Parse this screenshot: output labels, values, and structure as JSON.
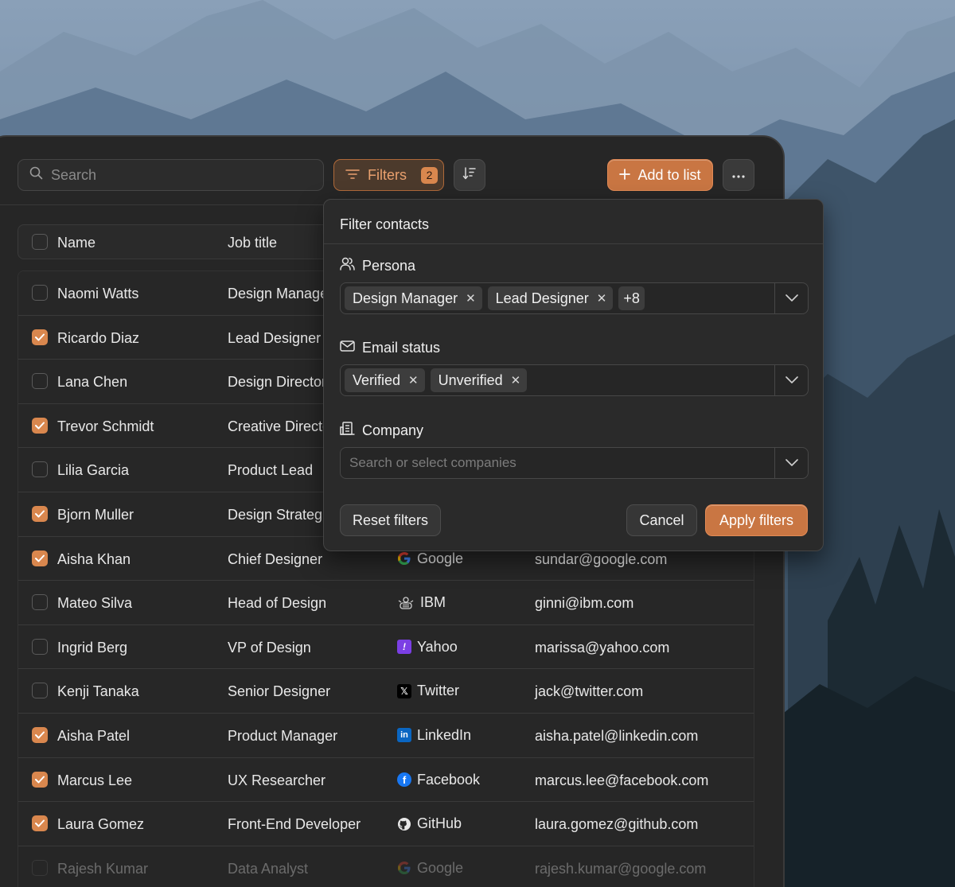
{
  "toolbar": {
    "search_placeholder": "Search",
    "filters_label": "Filters",
    "filters_count": "2",
    "add_label": "Add to list"
  },
  "table": {
    "headers": {
      "name": "Name",
      "job_title": "Job title"
    },
    "rows": [
      {
        "checked": false,
        "name": "Naomi Watts",
        "job": "Design Manager",
        "company": "",
        "company_icon": "",
        "email": ""
      },
      {
        "checked": true,
        "name": "Ricardo Diaz",
        "job": "Lead Designer",
        "company": "",
        "company_icon": "",
        "email": ""
      },
      {
        "checked": false,
        "name": "Lana Chen",
        "job": "Design Director",
        "company": "",
        "company_icon": "",
        "email": ""
      },
      {
        "checked": true,
        "name": "Trevor Schmidt",
        "job": "Creative Director",
        "company": "",
        "company_icon": "",
        "email": ""
      },
      {
        "checked": false,
        "name": "Lilia Garcia",
        "job": "Product Lead",
        "company": "",
        "company_icon": "",
        "email": ""
      },
      {
        "checked": true,
        "name": "Bjorn Muller",
        "job": "Design Strategist",
        "company": "",
        "company_icon": "",
        "email": ""
      },
      {
        "checked": true,
        "name": "Aisha Khan",
        "job": "Chief Designer",
        "company": "Google",
        "company_icon": "google-icon",
        "email": "sundar@google.com"
      },
      {
        "checked": false,
        "name": "Mateo Silva",
        "job": "Head of Design",
        "company": "IBM",
        "company_icon": "ibm-icon",
        "email": "ginni@ibm.com"
      },
      {
        "checked": false,
        "name": "Ingrid Berg",
        "job": "VP of Design",
        "company": "Yahoo",
        "company_icon": "yahoo-icon",
        "email": "marissa@yahoo.com"
      },
      {
        "checked": false,
        "name": "Kenji Tanaka",
        "job": "Senior Designer",
        "company": "Twitter",
        "company_icon": "x-icon",
        "email": "jack@twitter.com"
      },
      {
        "checked": true,
        "name": "Aisha Patel",
        "job": "Product Manager",
        "company": "LinkedIn",
        "company_icon": "linkedin-icon",
        "email": "aisha.patel@linkedin.com"
      },
      {
        "checked": true,
        "name": "Marcus Lee",
        "job": "UX Researcher",
        "company": "Facebook",
        "company_icon": "facebook-icon",
        "email": "marcus.lee@facebook.com"
      },
      {
        "checked": true,
        "name": "Laura Gomez",
        "job": "Front-End Developer",
        "company": "GitHub",
        "company_icon": "github-icon",
        "email": "laura.gomez@github.com"
      },
      {
        "checked": false,
        "name": "Rajesh Kumar",
        "job": "Data Analyst",
        "company": "Google",
        "company_icon": "google-icon",
        "email": "rajesh.kumar@google.com"
      }
    ]
  },
  "filter_popover": {
    "title": "Filter contacts",
    "persona": {
      "label": "Persona",
      "chips": [
        "Design Manager",
        "Lead Designer"
      ],
      "more": "+8"
    },
    "email_status": {
      "label": "Email status",
      "chips": [
        "Verified",
        "Unverified"
      ]
    },
    "company": {
      "label": "Company",
      "placeholder": "Search or select companies"
    },
    "reset_label": "Reset filters",
    "cancel_label": "Cancel",
    "apply_label": "Apply filters"
  },
  "colors": {
    "accent": "#c97643",
    "accent_light": "#e9a06e",
    "panel": "#262626",
    "row_border": "#3a3a3a"
  }
}
